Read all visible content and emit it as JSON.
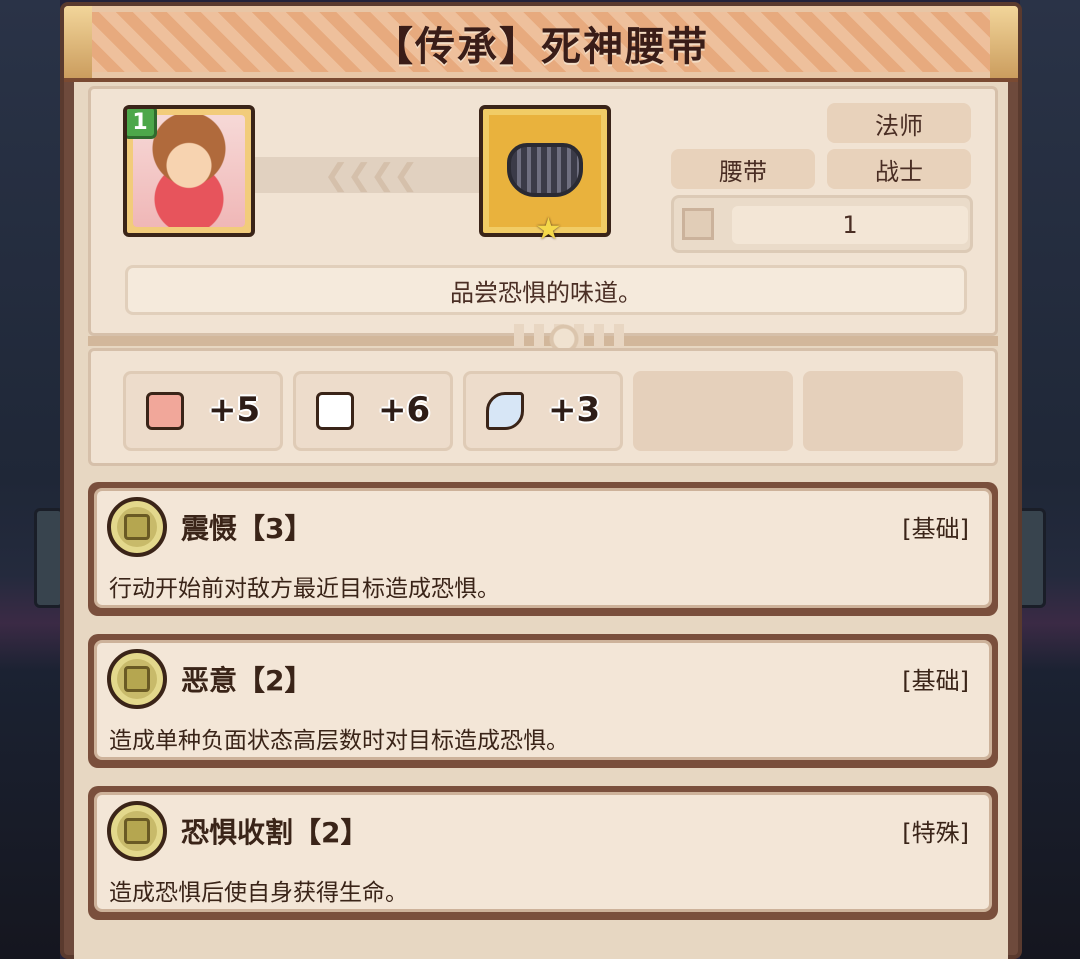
{
  "title": "【传承】死神腰带",
  "hero": {
    "level": "1"
  },
  "item": {
    "tags": {
      "mage": "法师",
      "belt": "腰带",
      "warrior": "战士"
    },
    "level_value": "1",
    "quote": "品尝恐惧的味道。"
  },
  "stats": [
    {
      "icon": "fist-icon",
      "value": "+5",
      "color": "#f1a79a"
    },
    {
      "icon": "book-icon",
      "value": "+6",
      "color": "#ffffff"
    },
    {
      "icon": "feather-icon",
      "value": "+3",
      "color": "#d7e6f6"
    }
  ],
  "skills": [
    {
      "name": "震慑【3】",
      "type": "[基础]",
      "desc": "行动开始前对敌方最近目标造成恐惧。"
    },
    {
      "name": "恶意【2】",
      "type": "[基础]",
      "desc": "造成单种负面状态高层数时对目标造成恐惧。"
    },
    {
      "name": "恐惧收割【2】",
      "type": "[特殊]",
      "desc": "造成恐惧后使自身获得生命。"
    }
  ]
}
